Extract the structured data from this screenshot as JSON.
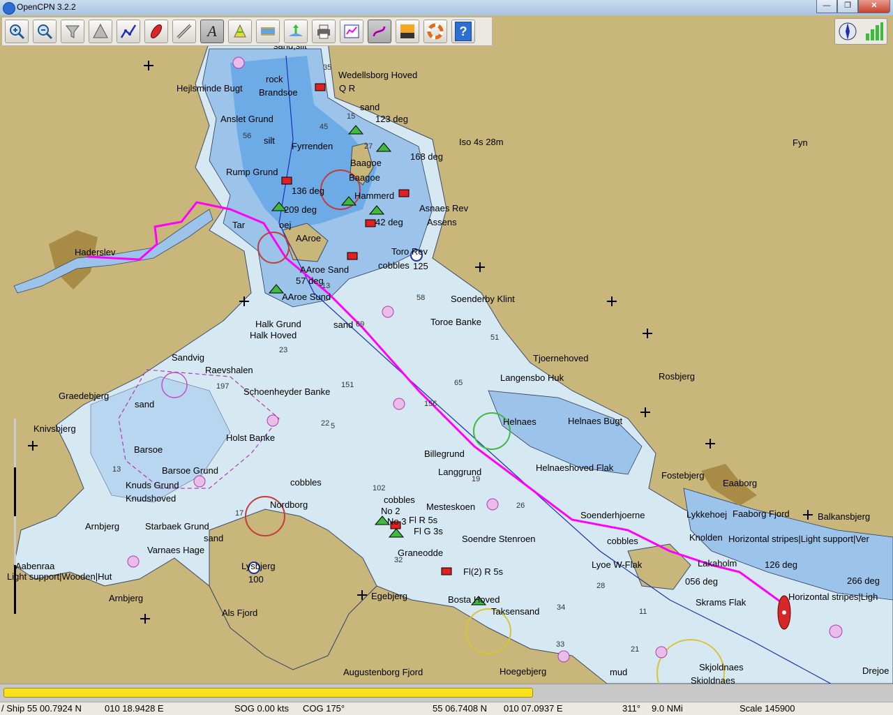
{
  "window": {
    "title": "OpenCPN 3.2.2",
    "minimize": "—",
    "maximize": "❐",
    "close": "✕"
  },
  "toolbar": {
    "zoom_in": "zoom-in",
    "zoom_out": "zoom-out",
    "scale_in": "scale-in",
    "scale_out": "scale-out",
    "route": "route",
    "ship": "ship",
    "measure": "measure",
    "text": "text",
    "mark": "mark",
    "tide": "tide",
    "current": "current",
    "print": "print",
    "route_manager": "route-manager",
    "track": "track",
    "color": "color",
    "mob": "man-overboard",
    "help": "help",
    "help_label": "?",
    "text_label": "A"
  },
  "map_labels": [
    {
      "id": "label-sand-silt",
      "text": "sand,silt"
    },
    {
      "id": "label-wedellsborg",
      "text": "Wedellsborg Hoved"
    },
    {
      "id": "label-rock",
      "text": "rock"
    },
    {
      "id": "label-hejlsminde",
      "text": "Hejlsminde Bugt"
    },
    {
      "id": "label-brandsoe",
      "text": "Brandsoe"
    },
    {
      "id": "label-qr",
      "text": "Q R"
    },
    {
      "id": "label-sand1",
      "text": "sand"
    },
    {
      "id": "label-123deg",
      "text": "123 deg"
    },
    {
      "id": "label-anslet",
      "text": "Anslet Grund"
    },
    {
      "id": "label-iso",
      "text": "Iso 4s 28m"
    },
    {
      "id": "label-silt",
      "text": "silt"
    },
    {
      "id": "label-fyrrenden",
      "text": "Fyrrenden"
    },
    {
      "id": "label-168deg",
      "text": "168 deg"
    },
    {
      "id": "label-fyn",
      "text": "Fyn"
    },
    {
      "id": "label-baagoe1",
      "text": "Baagoe"
    },
    {
      "id": "label-rump",
      "text": "Rump Grund"
    },
    {
      "id": "label-baagoe2",
      "text": "Baagoe"
    },
    {
      "id": "label-136deg",
      "text": "136 deg"
    },
    {
      "id": "label-hammerd",
      "text": "Hammerd"
    },
    {
      "id": "label-209deg",
      "text": "209 deg"
    },
    {
      "id": "label-asnaes",
      "text": "Asnaes Rev"
    },
    {
      "id": "label-tar",
      "text": "Tar"
    },
    {
      "id": "label-oej",
      "text": "oej"
    },
    {
      "id": "label-42deg",
      "text": "42 deg"
    },
    {
      "id": "label-assens",
      "text": "Assens"
    },
    {
      "id": "label-aaroe",
      "text": "AAroe"
    },
    {
      "id": "label-haderslev",
      "text": "Haderslev"
    },
    {
      "id": "label-toro-rev",
      "text": "Toro Rev"
    },
    {
      "id": "label-cobbles1",
      "text": "cobbles"
    },
    {
      "id": "label-125",
      "text": "125"
    },
    {
      "id": "label-aaroe-sand",
      "text": "AAroe Sand"
    },
    {
      "id": "label-57deg",
      "text": "57 deg"
    },
    {
      "id": "label-aaroe-sund",
      "text": "AAroe Sund"
    },
    {
      "id": "label-soenderby",
      "text": "Soenderby Klint"
    },
    {
      "id": "label-halk-grund",
      "text": "Halk Grund"
    },
    {
      "id": "label-sand2",
      "text": "sand"
    },
    {
      "id": "label-toroe-banke",
      "text": "Toroe Banke"
    },
    {
      "id": "label-halk-hoved",
      "text": "Halk Hoved"
    },
    {
      "id": "label-sandvig",
      "text": "Sandvig"
    },
    {
      "id": "label-tjoernehoved",
      "text": "Tjoernehoved"
    },
    {
      "id": "label-raevshalen",
      "text": "Raevshalen"
    },
    {
      "id": "label-langensbo",
      "text": "Langensbo Huk"
    },
    {
      "id": "label-rosbjerg",
      "text": "Rosbjerg"
    },
    {
      "id": "label-schoenheyder",
      "text": "Schoenheyder Banke"
    },
    {
      "id": "label-graedebjerg",
      "text": "Graedebjerg"
    },
    {
      "id": "label-sand3",
      "text": "sand"
    },
    {
      "id": "label-helnaes",
      "text": "Helnaes"
    },
    {
      "id": "label-helnaes-bugt",
      "text": "Helnaes Bugt"
    },
    {
      "id": "label-knivsbjerg",
      "text": "Knivsbjerg"
    },
    {
      "id": "label-holst",
      "text": "Holst Banke"
    },
    {
      "id": "label-barsoe",
      "text": "Barsoe"
    },
    {
      "id": "label-billegrund",
      "text": "Billegrund"
    },
    {
      "id": "label-helnaeshoved",
      "text": "Helnaeshoved Flak"
    },
    {
      "id": "label-langgrund",
      "text": "Langgrund"
    },
    {
      "id": "label-barsoe-grund",
      "text": "Barsoe Grund"
    },
    {
      "id": "label-fostebjerg",
      "text": "Fostebjerg"
    },
    {
      "id": "label-eaaborg",
      "text": "Eaaborg"
    },
    {
      "id": "label-knuds-grund",
      "text": "Knuds Grund"
    },
    {
      "id": "label-cobbles2",
      "text": "cobbles"
    },
    {
      "id": "label-knudshoved",
      "text": "Knudshoved"
    },
    {
      "id": "label-cobbles3",
      "text": "cobbles"
    },
    {
      "id": "label-nordborg",
      "text": "Nordborg"
    },
    {
      "id": "label-mesteskoen",
      "text": "Mesteskoen"
    },
    {
      "id": "label-no2",
      "text": "No 2"
    },
    {
      "id": "label-no3",
      "text": "No 3"
    },
    {
      "id": "label-flr5s",
      "text": "Fl R 5s"
    },
    {
      "id": "label-lykkehoej",
      "text": "Lykkehoej"
    },
    {
      "id": "label-faaborg",
      "text": "Faaborg Fjord"
    },
    {
      "id": "label-balkansbjerg",
      "text": "Balkansbjerg"
    },
    {
      "id": "label-arnbjerg1",
      "text": "Arnbjerg"
    },
    {
      "id": "label-starbaek",
      "text": "Starbaek Grund"
    },
    {
      "id": "label-flg3s",
      "text": "Fl G 3s"
    },
    {
      "id": "label-soenderhjoerne",
      "text": "Soenderhjoerne"
    },
    {
      "id": "label-sand4",
      "text": "sand"
    },
    {
      "id": "label-soendre",
      "text": "Soendre Stenroen"
    },
    {
      "id": "label-cobbles4",
      "text": "cobbles"
    },
    {
      "id": "label-knolden",
      "text": "Knolden"
    },
    {
      "id": "label-horizontal1",
      "text": "Horizontal stripes|Light support|Ver"
    },
    {
      "id": "label-aabenraa",
      "text": "Aabenraa"
    },
    {
      "id": "label-varnaes",
      "text": "Varnaes Hage"
    },
    {
      "id": "label-graneodde",
      "text": "Graneodde"
    },
    {
      "id": "label-lyoe",
      "text": "Lyoe W-Flak"
    },
    {
      "id": "label-lakaholm",
      "text": "Lakaholm"
    },
    {
      "id": "label-126deg",
      "text": "126 deg"
    },
    {
      "id": "label-light-support",
      "text": "Light support|Wooden|Hut"
    },
    {
      "id": "label-lysbjerg",
      "text": "Lysbjerg"
    },
    {
      "id": "label-100",
      "text": "100"
    },
    {
      "id": "label-flr5s2",
      "text": "Fl(2) R 5s"
    },
    {
      "id": "label-056deg",
      "text": "056 deg"
    },
    {
      "id": "label-266deg",
      "text": "266 deg"
    },
    {
      "id": "label-arnbjerg2",
      "text": "Arnbjerg"
    },
    {
      "id": "label-egebjerg",
      "text": "Egebjerg"
    },
    {
      "id": "label-bosta",
      "text": "Bosta Hoved"
    },
    {
      "id": "label-skrams",
      "text": "Skrams Flak"
    },
    {
      "id": "label-horizontal2",
      "text": "Horizontal stripes|Ligh"
    },
    {
      "id": "label-als",
      "text": "Als Fjord"
    },
    {
      "id": "label-taksensand",
      "text": "Taksensand"
    },
    {
      "id": "label-augustenborg",
      "text": "Augustenborg Fjord"
    },
    {
      "id": "label-hoegebjerg",
      "text": "Hoegebjerg"
    },
    {
      "id": "label-mud",
      "text": "mud"
    },
    {
      "id": "label-skjoldnaes1",
      "text": "Skjoldnaes"
    },
    {
      "id": "label-skjoldnaes2",
      "text": "Skjoldnaes"
    },
    {
      "id": "label-drejoe",
      "text": "Drejoe"
    }
  ],
  "depth_labels": [
    "35",
    "15",
    "45",
    "56",
    "27",
    "23",
    "69",
    "58",
    "13",
    "51",
    "197",
    "151",
    "65",
    "156",
    "22",
    "5",
    "17",
    "102",
    "26",
    "19",
    "32",
    "28",
    "34",
    "33",
    "21",
    "11",
    "13"
  ],
  "progress": {
    "fraction": 0.598
  },
  "status": {
    "ship": "/ Ship 55 00.7924 N",
    "ship_lon": "010 18.9428 E",
    "sog": "SOG 0.00 kts",
    "cog": "COG 175°",
    "cursor_lat": "55 06.7408 N",
    "cursor_lon": "010 07.0937 E",
    "bearing": "311°",
    "distance": "9.0 NMi",
    "scale": "Scale 145900"
  },
  "colors": {
    "land": "#c8b67a",
    "deep_water": "#d6e9f2",
    "shallow": "#9cc4ea",
    "very_shallow": "#5ea3e4",
    "route": "#ff00ff",
    "ship": "#d62828"
  }
}
